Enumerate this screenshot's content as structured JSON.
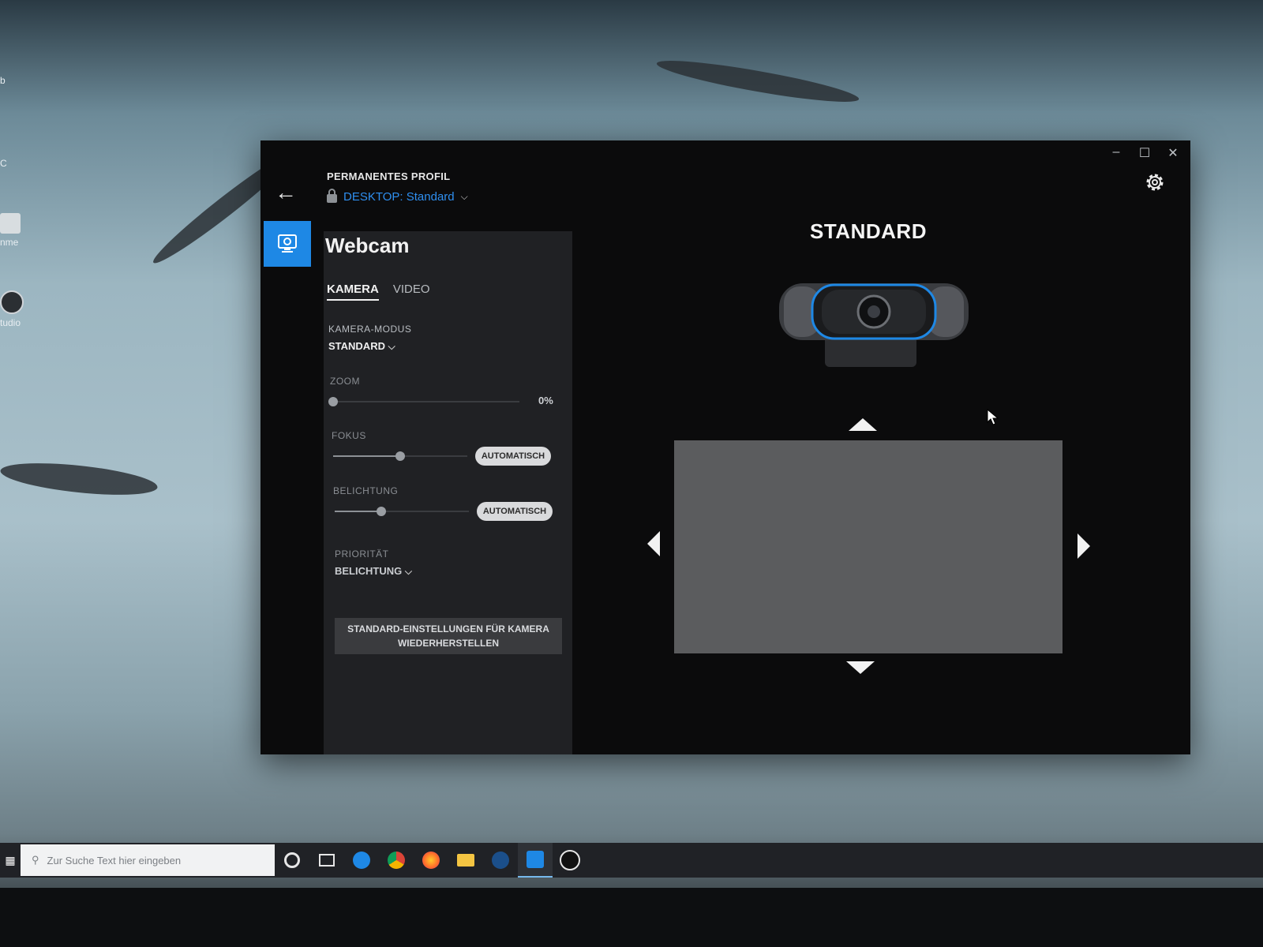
{
  "desktop": {
    "icons": [
      {
        "label": "b"
      },
      {
        "label": "C"
      },
      {
        "label": "nme"
      },
      {
        "label": "tudio"
      }
    ]
  },
  "window": {
    "controls": {
      "minimize": "–",
      "maximize": "☐",
      "close": "✕"
    },
    "profile": {
      "label": "PERMANENTES PROFIL",
      "value": "DESKTOP: Standard"
    },
    "device_name": "Webcam",
    "tabs": [
      {
        "label": "KAMERA",
        "active": true
      },
      {
        "label": "VIDEO",
        "active": false
      }
    ],
    "camera_mode": {
      "label": "KAMERA-MODUS",
      "value": "STANDARD"
    },
    "zoom": {
      "label": "ZOOM",
      "value_text": "0%",
      "level": 0
    },
    "focus": {
      "label": "FOKUS",
      "button": "AUTOMATISCH",
      "level": 0.5
    },
    "exposure": {
      "label": "BELICHTUNG",
      "button": "AUTOMATISCH",
      "level": 0.35
    },
    "priority": {
      "label": "PRIORITÄT",
      "value": "BELICHTUNG"
    },
    "reset_button": {
      "line1": "STANDARD-EINSTELLUNGEN FÜR KAMERA",
      "line2": "WIEDERHERSTELLEN"
    },
    "mode_title": "STANDARD",
    "accent_color": "#1e88e5"
  },
  "taskbar": {
    "search_placeholder": "Zur Suche Text hier eingeben",
    "icons": [
      "cortana-icon",
      "task-view-icon",
      "edge-icon",
      "chrome-icon",
      "firefox-icon",
      "file-explorer-icon",
      "steam-icon",
      "logitech-app-icon",
      "logitech-g-hub-icon"
    ]
  }
}
